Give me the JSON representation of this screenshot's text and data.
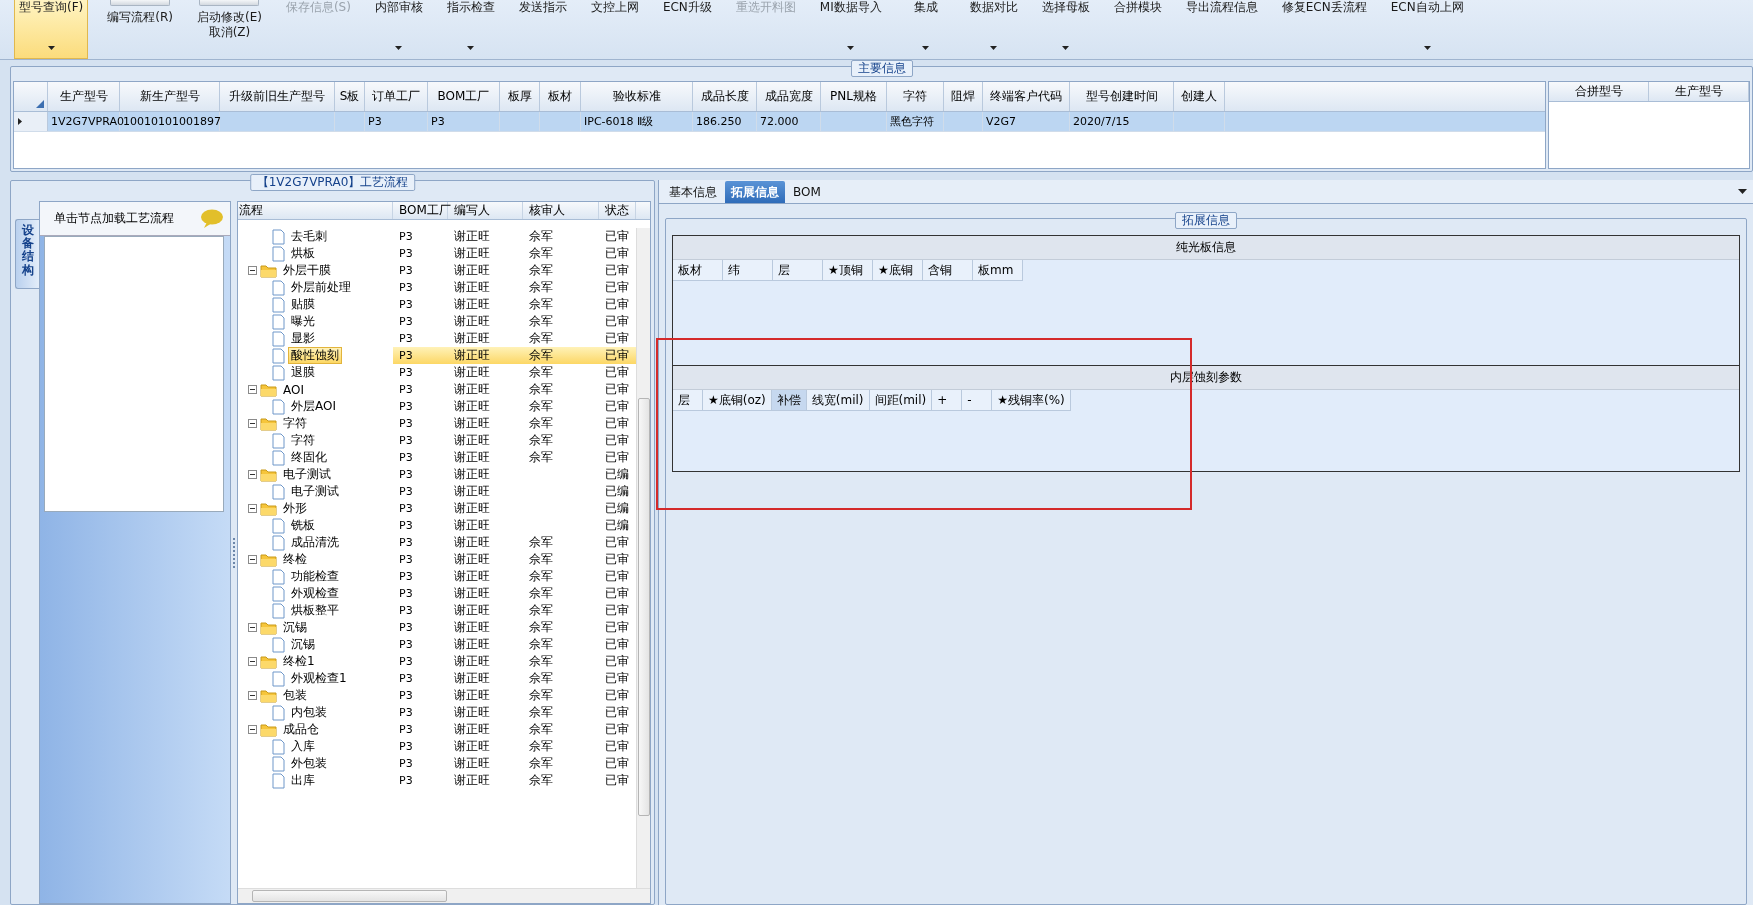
{
  "toolbar": [
    {
      "label": "型号查询(F)",
      "kind": "large",
      "dropdown": true,
      "selected": true,
      "disabled": false
    },
    {
      "label": "编写流程(R)",
      "kind": "small",
      "dropdown": false,
      "selected": false,
      "disabled": false
    },
    {
      "label": "启动修改(E)",
      "sublabel": "取消(Z)",
      "kind": "small",
      "dropdown": false,
      "selected": false,
      "disabled": false
    },
    {
      "label": "保存信息(S)",
      "kind": "large",
      "dropdown": false,
      "selected": false,
      "disabled": true
    },
    {
      "label": "内部审核",
      "kind": "large",
      "dropdown": true,
      "selected": false,
      "disabled": false
    },
    {
      "label": "指示检查",
      "kind": "large",
      "dropdown": true,
      "selected": false,
      "disabled": false
    },
    {
      "label": "发送指示",
      "kind": "large",
      "dropdown": false,
      "selected": false,
      "disabled": false
    },
    {
      "label": "文控上网",
      "kind": "large",
      "dropdown": false,
      "selected": false,
      "disabled": false
    },
    {
      "label": "ECN升级",
      "kind": "large",
      "dropdown": false,
      "selected": false,
      "disabled": false
    },
    {
      "label": "重选开料图",
      "kind": "large",
      "dropdown": false,
      "selected": false,
      "disabled": true
    },
    {
      "label": "MI数据导入",
      "kind": "large",
      "dropdown": true,
      "selected": false,
      "disabled": false
    },
    {
      "label": "集成",
      "kind": "large",
      "dropdown": true,
      "selected": false,
      "disabled": false
    },
    {
      "label": "数据对比",
      "kind": "large",
      "dropdown": true,
      "selected": false,
      "disabled": false
    },
    {
      "label": "选择母板",
      "kind": "large",
      "dropdown": true,
      "selected": false,
      "disabled": false
    },
    {
      "label": "合拼模块",
      "kind": "large",
      "dropdown": false,
      "selected": false,
      "disabled": false
    },
    {
      "label": "导出流程信息",
      "kind": "large",
      "dropdown": false,
      "selected": false,
      "disabled": false
    },
    {
      "label": "修复ECN丢流程",
      "kind": "large",
      "dropdown": false,
      "selected": false,
      "disabled": false
    },
    {
      "label": "ECN自动上网",
      "kind": "large",
      "dropdown": true,
      "selected": false,
      "disabled": false
    }
  ],
  "main_info": {
    "title": "主要信息",
    "columns": [
      "生产型号",
      "新生产型号",
      "升级前旧生产型号",
      "S板",
      "订单工厂",
      "BOM工厂",
      "板厚",
      "板材",
      "验收标准",
      "成品长度",
      "成品宽度",
      "PNL规格",
      "字符",
      "阻焊",
      "终端客户代码",
      "型号创建时间",
      "创建人"
    ],
    "rows": [
      {
        "selected": true,
        "cells": [
          "1V2G7VPRA0",
          "10010101001897",
          null,
          null,
          "P3",
          "P3",
          null,
          null,
          "IPC-6018 Ⅱ级",
          "186.250",
          "72.000",
          null,
          "黑色字符",
          null,
          "V2G7",
          "2020/7/15",
          null
        ]
      }
    ],
    "side_columns": [
      "合拼型号",
      "生产型号"
    ]
  },
  "process": {
    "title": "【1V2G7VPRA0】工艺流程",
    "side_tab": "设备结构",
    "hint": "单击节点加载工艺流程",
    "columns": [
      "流程",
      "BOM工厂",
      "编写人",
      "核审人",
      "状态"
    ],
    "tree": [
      {
        "children": [
          {
            "name": "去毛刺",
            "bom": "P3",
            "writer": "谢正旺",
            "reviewer": "佘军",
            "status": "已审",
            "selected": false
          },
          {
            "name": "烘板",
            "bom": "P3",
            "writer": "谢正旺",
            "reviewer": "佘军",
            "status": "已审",
            "selected": false
          }
        ]
      },
      {
        "name": "外层干膜",
        "bom": "P3",
        "writer": "谢正旺",
        "reviewer": "佘军",
        "status": "已审",
        "selected": false,
        "children": [
          {
            "name": "外层前处理",
            "bom": "P3",
            "writer": "谢正旺",
            "reviewer": "佘军",
            "status": "已审",
            "selected": false
          },
          {
            "name": "贴膜",
            "bom": "P3",
            "writer": "谢正旺",
            "reviewer": "佘军",
            "status": "已审",
            "selected": false
          },
          {
            "name": "曝光",
            "bom": "P3",
            "writer": "谢正旺",
            "reviewer": "佘军",
            "status": "已审",
            "selected": false
          },
          {
            "name": "显影",
            "bom": "P3",
            "writer": "谢正旺",
            "reviewer": "佘军",
            "status": "已审",
            "selected": false
          },
          {
            "name": "酸性蚀刻",
            "bom": "P3",
            "writer": "谢正旺",
            "reviewer": "佘军",
            "status": "已审",
            "selected": true
          },
          {
            "name": "退膜",
            "bom": "P3",
            "writer": "谢正旺",
            "reviewer": "佘军",
            "status": "已审",
            "selected": false
          }
        ]
      },
      {
        "name": "AOI",
        "bom": "P3",
        "writer": "谢正旺",
        "reviewer": "佘军",
        "status": "已审",
        "selected": false,
        "children": [
          {
            "name": "外层AOI",
            "bom": "P3",
            "writer": "谢正旺",
            "reviewer": "佘军",
            "status": "已审",
            "selected": false
          }
        ]
      },
      {
        "name": "字符",
        "bom": "P3",
        "writer": "谢正旺",
        "reviewer": "佘军",
        "status": "已审",
        "selected": false,
        "children": [
          {
            "name": "字符",
            "bom": "P3",
            "writer": "谢正旺",
            "reviewer": "佘军",
            "status": "已审",
            "selected": false
          },
          {
            "name": "终固化",
            "bom": "P3",
            "writer": "谢正旺",
            "reviewer": "佘军",
            "status": "已审",
            "selected": false
          }
        ]
      },
      {
        "name": "电子测试",
        "bom": "P3",
        "writer": "谢正旺",
        "status": "已编",
        "selected": false,
        "children": [
          {
            "name": "电子测试",
            "bom": "P3",
            "writer": "谢正旺",
            "status": "已编",
            "selected": false
          }
        ]
      },
      {
        "name": "外形",
        "bom": "P3",
        "writer": "谢正旺",
        "status": "已编",
        "selected": false,
        "children": [
          {
            "name": "铣板",
            "bom": "P3",
            "writer": "谢正旺",
            "status": "已编",
            "selected": false
          },
          {
            "name": "成品清洗",
            "bom": "P3",
            "writer": "谢正旺",
            "reviewer": "佘军",
            "status": "已审",
            "selected": false
          }
        ]
      },
      {
        "name": "终检",
        "bom": "P3",
        "writer": "谢正旺",
        "reviewer": "佘军",
        "status": "已审",
        "selected": false,
        "children": [
          {
            "name": "功能检查",
            "bom": "P3",
            "writer": "谢正旺",
            "reviewer": "佘军",
            "status": "已审",
            "selected": false
          },
          {
            "name": "外观检查",
            "bom": "P3",
            "writer": "谢正旺",
            "reviewer": "佘军",
            "status": "已审",
            "selected": false
          },
          {
            "name": "烘板整平",
            "bom": "P3",
            "writer": "谢正旺",
            "reviewer": "佘军",
            "status": "已审",
            "selected": false
          }
        ]
      },
      {
        "name": "沉锡",
        "bom": "P3",
        "writer": "谢正旺",
        "reviewer": "佘军",
        "status": "已审",
        "selected": false,
        "children": [
          {
            "name": "沉锡",
            "bom": "P3",
            "writer": "谢正旺",
            "reviewer": "佘军",
            "status": "已审",
            "selected": false
          }
        ]
      },
      {
        "name": "终检1",
        "bom": "P3",
        "writer": "谢正旺",
        "reviewer": "佘军",
        "status": "已审",
        "selected": false,
        "children": [
          {
            "name": "外观检查1",
            "bom": "P3",
            "writer": "谢正旺",
            "reviewer": "佘军",
            "status": "已审",
            "selected": false
          }
        ]
      },
      {
        "name": "包装",
        "bom": "P3",
        "writer": "谢正旺",
        "reviewer": "佘军",
        "status": "已审",
        "selected": false,
        "children": [
          {
            "name": "内包装",
            "bom": "P3",
            "writer": "谢正旺",
            "reviewer": "佘军",
            "status": "已审",
            "selected": false
          }
        ]
      },
      {
        "name": "成品仓",
        "bom": "P3",
        "writer": "谢正旺",
        "reviewer": "佘军",
        "status": "已审",
        "selected": false,
        "children": [
          {
            "name": "入库",
            "bom": "P3",
            "writer": "谢正旺",
            "reviewer": "佘军",
            "status": "已审",
            "selected": false
          },
          {
            "name": "外包装",
            "bom": "P3",
            "writer": "谢正旺",
            "reviewer": "佘军",
            "status": "已审",
            "selected": false
          },
          {
            "name": "出库",
            "bom": "P3",
            "writer": "谢正旺",
            "reviewer": "佘军",
            "status": "已审",
            "selected": false
          }
        ]
      }
    ]
  },
  "detail_tabs": [
    {
      "label": "基本信息",
      "selected": false
    },
    {
      "label": "拓展信息",
      "selected": true
    },
    {
      "label": "BOM",
      "selected": false
    }
  ],
  "extended_info": {
    "title": "拓展信息",
    "sections": [
      {
        "title": "纯光板信息",
        "columns": [
          {
            "label": "板材",
            "selected": false
          },
          {
            "label": "纬",
            "selected": false
          },
          {
            "label": "层",
            "selected": false
          },
          {
            "label": "★顶铜",
            "selected": false
          },
          {
            "label": "★底铜",
            "selected": false
          },
          {
            "label": "含铜",
            "selected": false
          },
          {
            "label": "板mm",
            "selected": false
          }
        ]
      },
      {
        "title": "内层蚀刻参数",
        "columns": [
          {
            "label": "层",
            "selected": false
          },
          {
            "label": "★底铜(oz)",
            "selected": false
          },
          {
            "label": "补偿",
            "selected": true
          },
          {
            "label": "线宽(mil)",
            "selected": false
          },
          {
            "label": "间距(mil)",
            "selected": false
          },
          {
            "label": "+",
            "selected": false
          },
          {
            "label": "-",
            "selected": false
          },
          {
            "label": "★残铜率(%)",
            "selected": false
          }
        ]
      }
    ]
  }
}
